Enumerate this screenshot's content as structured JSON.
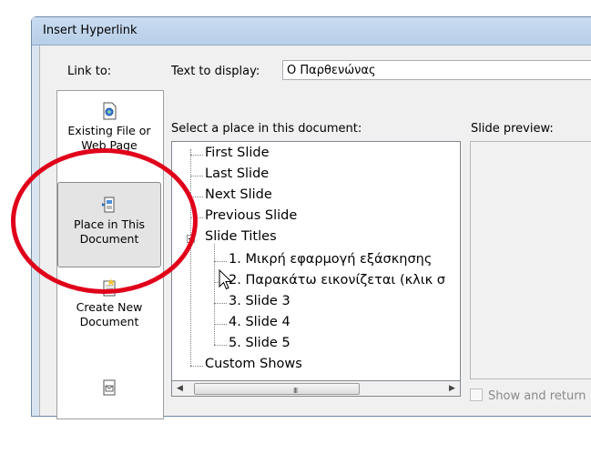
{
  "window": {
    "title": "Insert Hyperlink"
  },
  "link_to": {
    "label": "Link to:",
    "items": [
      {
        "label_line1": "Existing File or",
        "label_line2": "Web Page",
        "icon": "existing-file-icon",
        "accel": "x"
      },
      {
        "label_line1": "Place in This",
        "label_line2": "Document",
        "icon": "place-in-document-icon",
        "accel": "a",
        "selected": true
      },
      {
        "label_line1": "Create New",
        "label_line2": "Document",
        "icon": "new-document-icon",
        "accel": "N"
      },
      {
        "label_line1": "",
        "label_line2": "",
        "icon": "email-address-icon"
      }
    ]
  },
  "text_to_display": {
    "label": "Text to display:",
    "value": "Ο Παρθενώνας"
  },
  "place_list": {
    "label": "Select a place in this document:",
    "items": [
      {
        "text": "First Slide"
      },
      {
        "text": "Last Slide"
      },
      {
        "text": "Next Slide"
      },
      {
        "text": "Previous Slide"
      },
      {
        "text": "Slide Titles"
      },
      {
        "text": "1. Μικρή εφαρμογή εξάσκησης"
      },
      {
        "text": "2. Παρακάτω εικονίζεται (κλικ σ"
      },
      {
        "text": "3. Slide 3"
      },
      {
        "text": "4. Slide 4"
      },
      {
        "text": "5. Slide 5"
      },
      {
        "text": "Custom Shows"
      }
    ],
    "scroll_grip": "III"
  },
  "preview": {
    "label": "Slide preview:",
    "show_and_return": "Show and return"
  },
  "colors": {
    "highlight_ellipse": "#e0001a",
    "dialog_frame": "#d9e4f1"
  }
}
